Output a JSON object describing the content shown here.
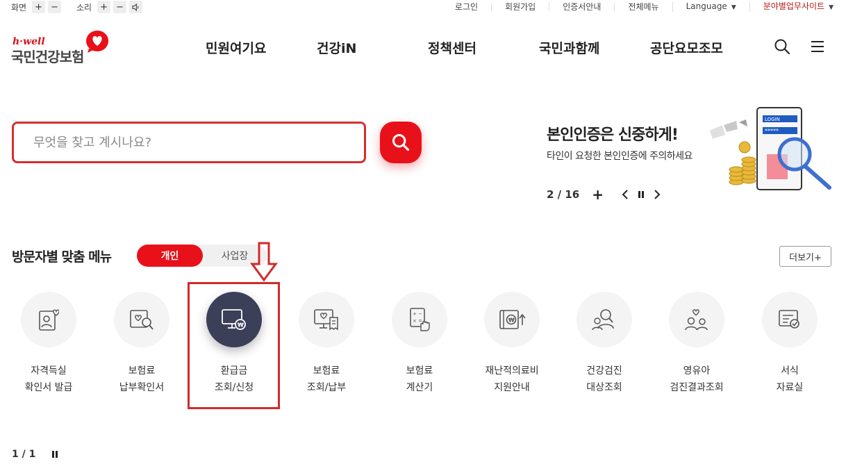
{
  "util": {
    "screen_label": "화면",
    "sound_label": "소리",
    "plus": "+",
    "minus": "−",
    "links": [
      "로그인",
      "회원가입",
      "인증서안내",
      "전체메뉴",
      "Language",
      "분야별업무사이트"
    ]
  },
  "logo": {
    "sub": "h·well",
    "main": "국민건강보험"
  },
  "gnb": [
    "민원여기요",
    "건강iN",
    "정책센터",
    "국민과함께",
    "공단요모조모"
  ],
  "search": {
    "placeholder": "무엇을 찾고 계시나요?"
  },
  "banner": {
    "title": "본인인증은 신중하게!",
    "desc": "타인이 요청한 본인인증에 주의하세요",
    "page": "2 / 16",
    "art_login": "LOGIN",
    "art_password": "*****"
  },
  "section": {
    "title": "방문자별 맞춤 메뉴",
    "toggle_on": "개인",
    "toggle_off": "사업장",
    "more": "더보기+"
  },
  "menu": [
    {
      "l1": "자격득실",
      "l2": "확인서 발급",
      "icon": "qualification-icon"
    },
    {
      "l1": "보험료",
      "l2": "납부확인서",
      "icon": "payment-confirm-icon"
    },
    {
      "l1": "환급금",
      "l2": "조회/신청",
      "icon": "refund-icon",
      "active": true
    },
    {
      "l1": "보험료",
      "l2": "조회/납부",
      "icon": "premium-inquiry-icon"
    },
    {
      "l1": "보험료",
      "l2": "계산기",
      "icon": "calculator-icon"
    },
    {
      "l1": "재난적의료비",
      "l2": "지원안내",
      "icon": "medical-support-icon"
    },
    {
      "l1": "건강검진",
      "l2": "대상조회",
      "icon": "checkup-icon"
    },
    {
      "l1": "영유아",
      "l2": "검진결과조회",
      "icon": "infant-icon"
    },
    {
      "l1": "서식",
      "l2": "자료실",
      "icon": "forms-icon"
    }
  ],
  "bottom": {
    "page": "1 / 1"
  },
  "colors": {
    "accent": "#e8111a",
    "active_circle": "#3b3f58",
    "annotation": "#d12a2a"
  }
}
